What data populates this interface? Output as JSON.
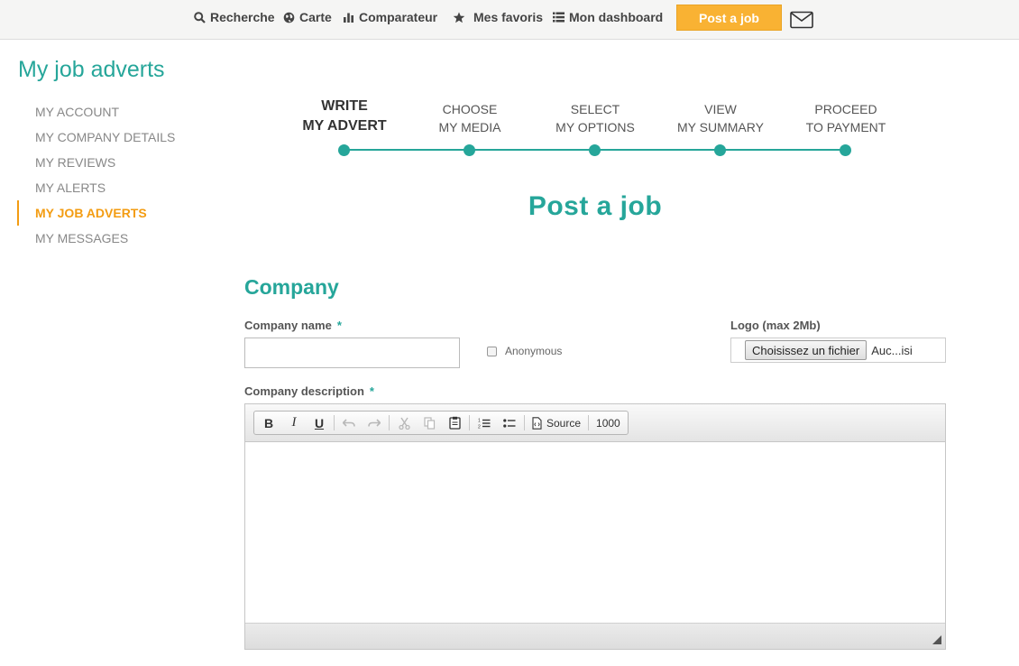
{
  "nav": {
    "items": [
      {
        "label": "Recherche",
        "icon": "search-icon"
      },
      {
        "label": "Carte",
        "icon": "globe-icon"
      },
      {
        "label": "Comparateur",
        "icon": "bar-chart-icon"
      },
      {
        "label": "Mes favoris",
        "icon": "star-icon"
      },
      {
        "label": "Mon dashboard",
        "icon": "list-icon"
      }
    ],
    "post_button": "Post a job",
    "mail_icon": "envelope-icon"
  },
  "page_title": "My job adverts",
  "sidebar": {
    "items": [
      {
        "label": "MY ACCOUNT"
      },
      {
        "label": "MY COMPANY DETAILS"
      },
      {
        "label": "MY REVIEWS"
      },
      {
        "label": "MY ALERTS"
      },
      {
        "label": "MY JOB ADVERTS",
        "active": true
      },
      {
        "label": "MY MESSAGES"
      }
    ]
  },
  "stepper": {
    "steps": [
      {
        "line1": "WRITE",
        "line2": "MY ADVERT",
        "current": true
      },
      {
        "line1": "CHOOSE",
        "line2": "MY MEDIA"
      },
      {
        "line1": "SELECT",
        "line2": "MY OPTIONS"
      },
      {
        "line1": "VIEW",
        "line2": "MY SUMMARY"
      },
      {
        "line1": "PROCEED",
        "line2": "TO PAYMENT"
      }
    ]
  },
  "form": {
    "title": "Post a job",
    "section": "Company",
    "company_name": {
      "label": "Company name",
      "required": "*",
      "value": ""
    },
    "anonymous": {
      "label": "Anonymous",
      "checked": false
    },
    "logo": {
      "label": "Logo (max 2Mb)",
      "button": "Choisissez un fichier",
      "status": "Auc...isi"
    },
    "company_description": {
      "label": "Company description",
      "required": "*",
      "value": ""
    },
    "toolbar": {
      "bold": "B",
      "italic": "I",
      "underline": "U",
      "source": "Source",
      "counter": "1000"
    }
  },
  "colors": {
    "accent": "#26a69a",
    "highlight": "#f39c12",
    "button": "#f9b233"
  }
}
